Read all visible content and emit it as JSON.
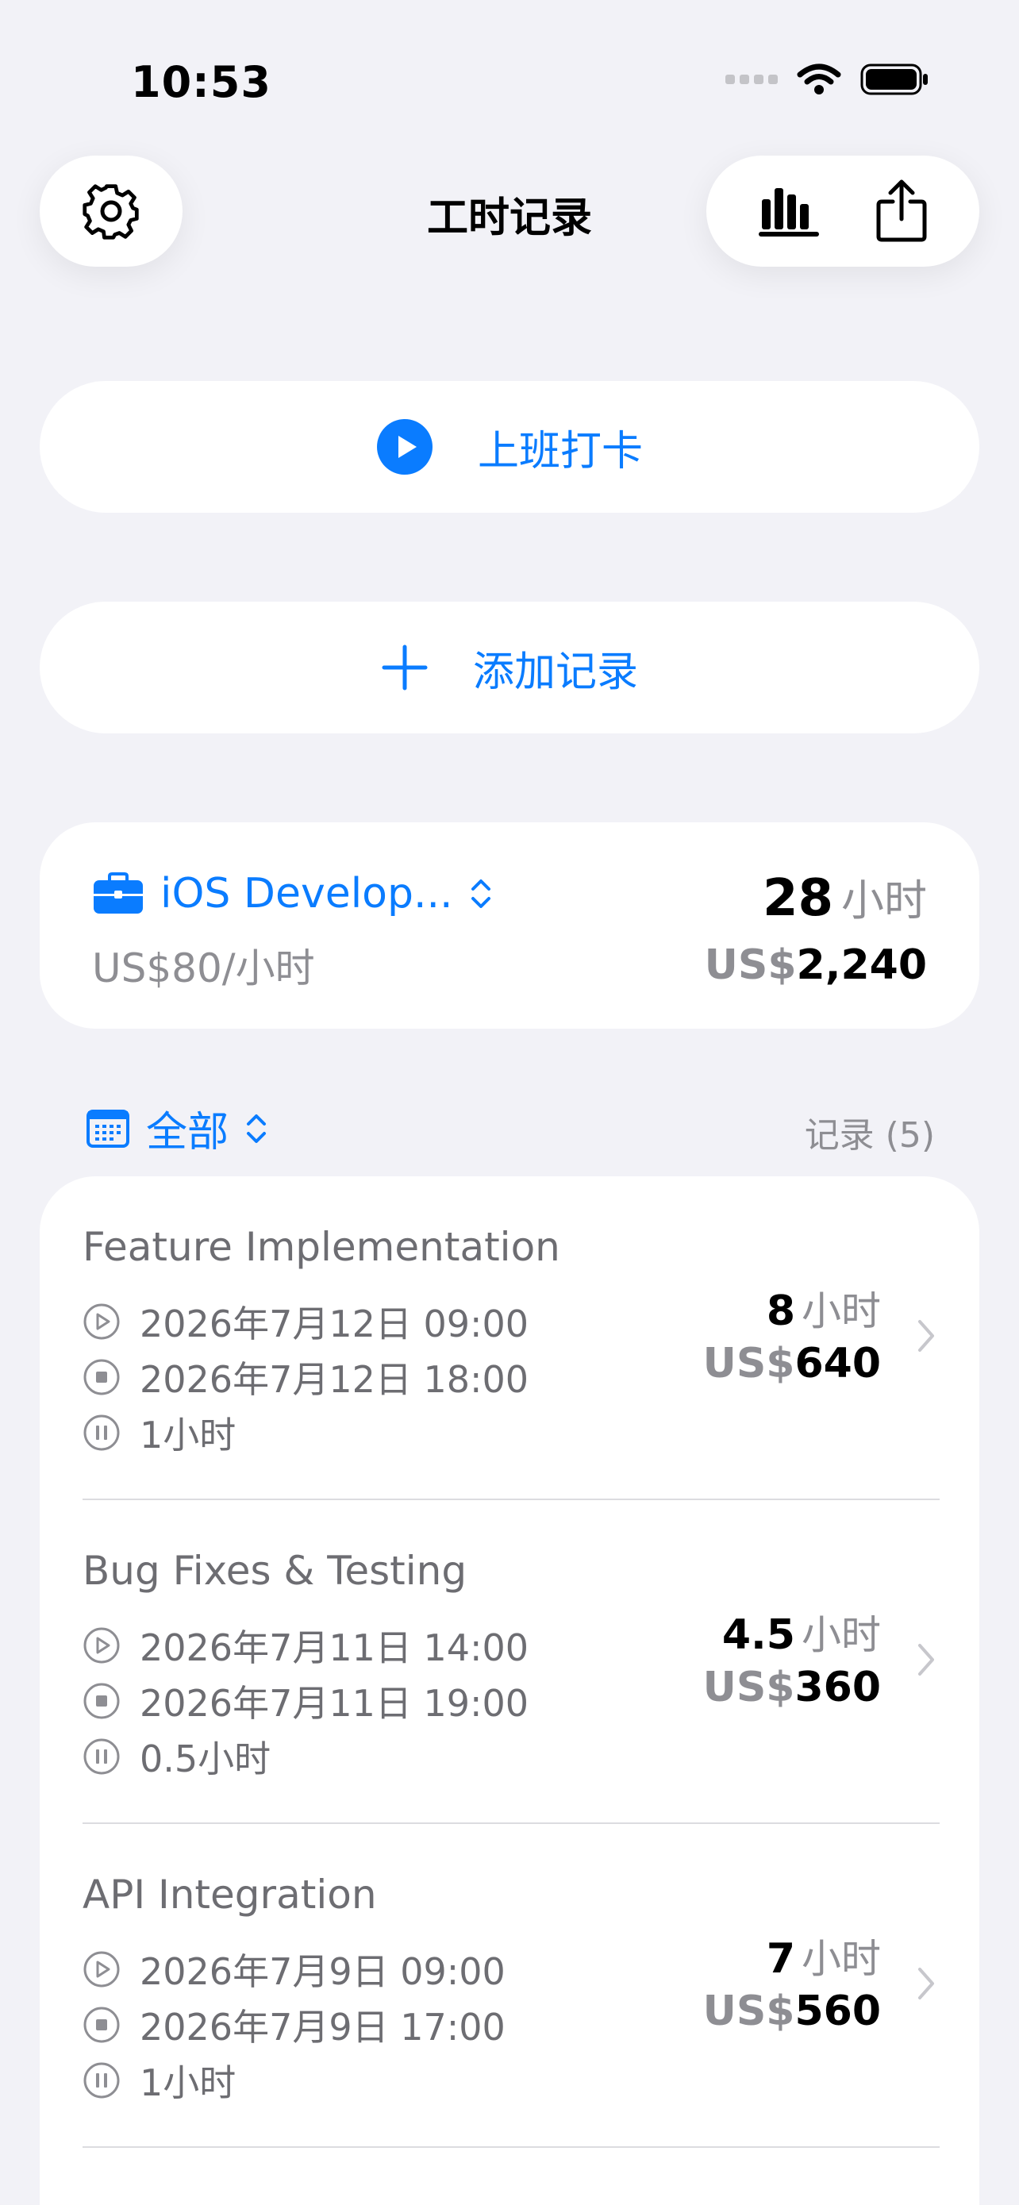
{
  "status_bar": {
    "time": "10:53"
  },
  "nav": {
    "title": "工时记录"
  },
  "actions": {
    "clock_in": "上班打卡",
    "add_record": "添加记录"
  },
  "summary": {
    "job_name": "iOS Develop...",
    "rate": "US$80/小时",
    "total_hours": "28",
    "hours_unit": "小时",
    "currency_prefix": "US$",
    "total_amount": "2,240"
  },
  "filter": {
    "label": "全部",
    "records_label": "记录 (5)"
  },
  "records": [
    {
      "title": "Feature Implementation",
      "start": "2026年7月12日 09:00",
      "end": "2026年7月12日 18:00",
      "break": "1小时",
      "hours": "8",
      "hours_unit": "小时",
      "currency_prefix": "US$",
      "amount": "640"
    },
    {
      "title": "Bug Fixes & Testing",
      "start": "2026年7月11日 14:00",
      "end": "2026年7月11日 19:00",
      "break": "0.5小时",
      "hours": "4.5",
      "hours_unit": "小时",
      "currency_prefix": "US$",
      "amount": "360"
    },
    {
      "title": "API Integration",
      "start": "2026年7月9日 09:00",
      "end": "2026年7月9日 17:00",
      "break": "1小时",
      "hours": "7",
      "hours_unit": "小时",
      "currency_prefix": "US$",
      "amount": "560"
    }
  ],
  "colors": {
    "accent": "#0a7cff",
    "background": "#f2f2f7",
    "secondary_text": "#8e8e93"
  },
  "icons": [
    "gear-icon",
    "bar-chart-icon",
    "share-icon",
    "play-circle-icon",
    "plus-icon",
    "briefcase-icon",
    "calendar-icon",
    "chevron-updown-icon",
    "play-outline-icon",
    "stop-outline-icon",
    "pause-outline-icon",
    "chevron-right-icon"
  ]
}
